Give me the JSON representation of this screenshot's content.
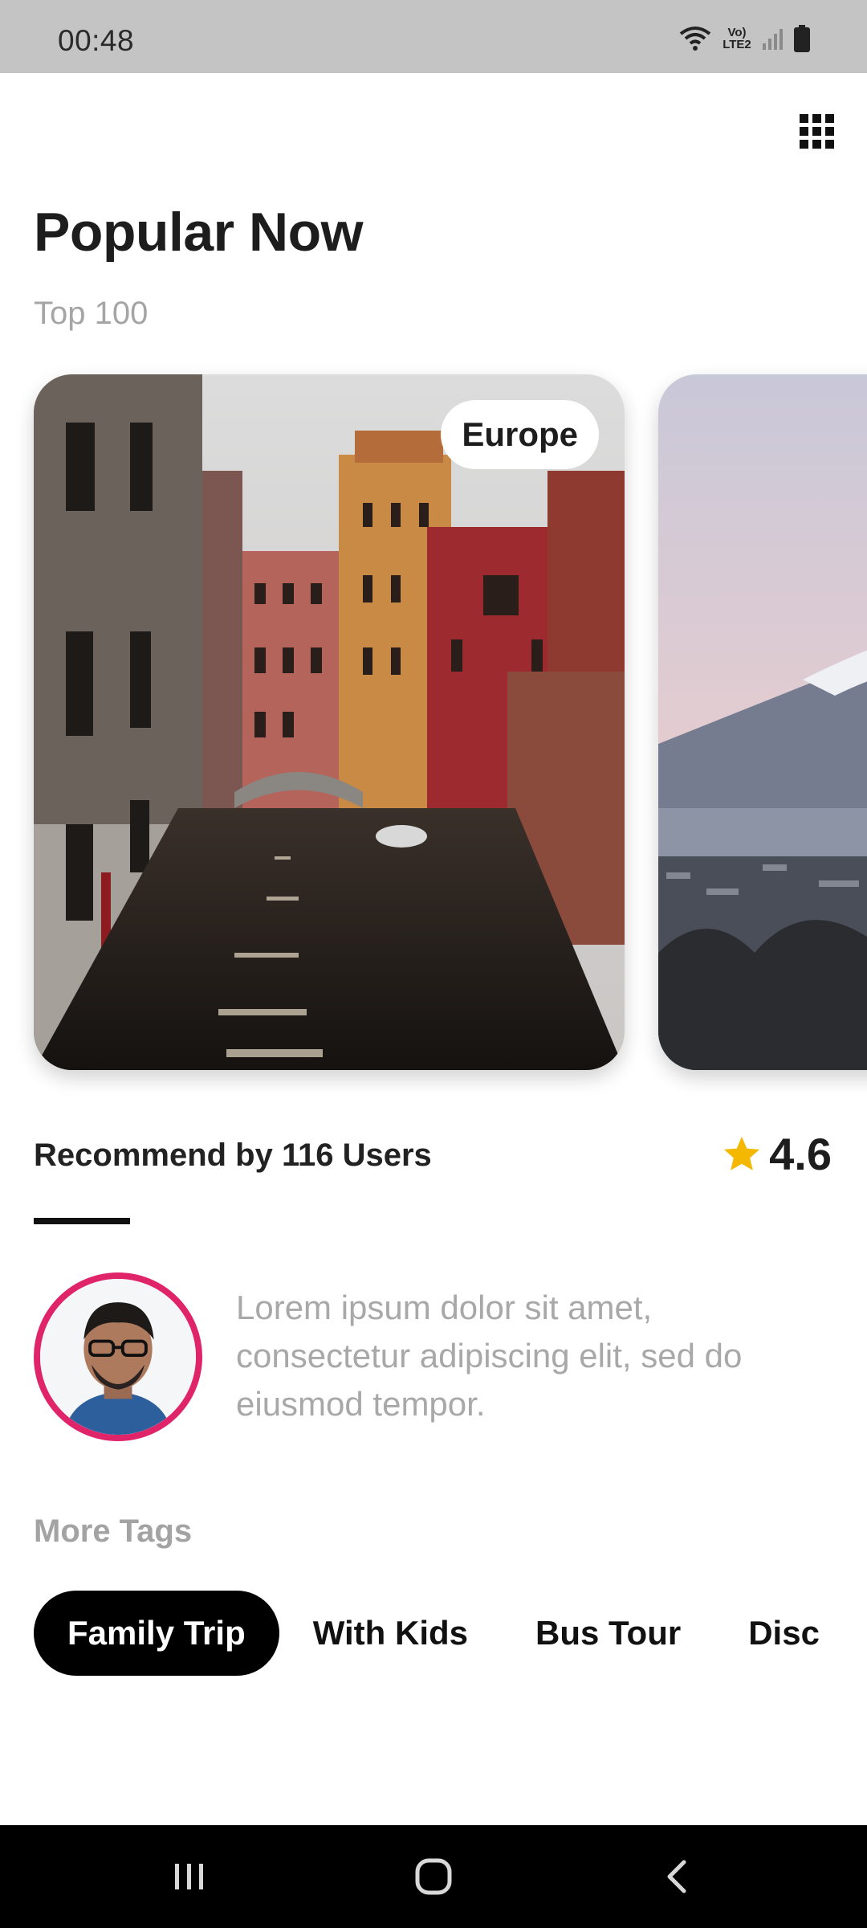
{
  "status_bar": {
    "time": "00:48",
    "network_label": "Vo) LTE2"
  },
  "header": {
    "menu_icon": "grid-icon"
  },
  "title": "Popular Now",
  "subtitle": "Top 100",
  "cards": [
    {
      "region": "Europe",
      "scene": "venice-canal-photo"
    },
    {
      "scene": "mount-fuji-photo"
    }
  ],
  "recommendation": {
    "text": "Recommend by 116 Users",
    "rating": "4.6"
  },
  "review": {
    "text": "Lorem ipsum dolor sit amet, consectetur adipiscing elit, sed do eiusmod tempor."
  },
  "more_tags_label": "More Tags",
  "tags": [
    {
      "label": "Family Trip",
      "active": true
    },
    {
      "label": "With Kids",
      "active": false
    },
    {
      "label": "Bus Tour",
      "active": false
    },
    {
      "label": "Disc",
      "active": false
    }
  ],
  "colors": {
    "accent_ring": "#e0246a",
    "star": "#f5b800",
    "tag_active_bg": "#000000"
  }
}
